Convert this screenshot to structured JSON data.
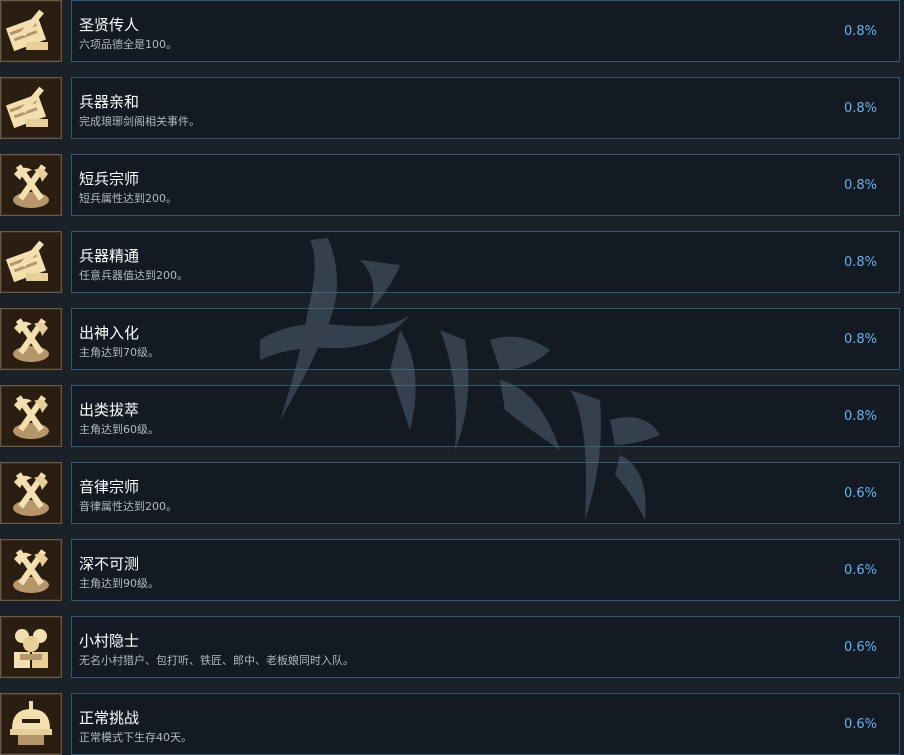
{
  "achievements": [
    {
      "title": "圣贤传人",
      "desc": "六项品德全是100。",
      "percent": "0.8%",
      "icon": "scroll-brush-icon"
    },
    {
      "title": "兵器亲和",
      "desc": "完成琅琊剑阁相关事件。",
      "percent": "0.8%",
      "icon": "scroll-brush-icon"
    },
    {
      "title": "短兵宗师",
      "desc": "短兵属性达到200。",
      "percent": "0.8%",
      "icon": "crossed-weapons-icon"
    },
    {
      "title": "兵器精通",
      "desc": "任意兵器值达到200。",
      "percent": "0.8%",
      "icon": "scroll-brush-icon"
    },
    {
      "title": "出神入化",
      "desc": "主角达到70级。",
      "percent": "0.8%",
      "icon": "crossed-weapons-icon"
    },
    {
      "title": "出类拔萃",
      "desc": "主角达到60级。",
      "percent": "0.8%",
      "icon": "crossed-weapons-icon"
    },
    {
      "title": "音律宗师",
      "desc": "音律属性达到200。",
      "percent": "0.6%",
      "icon": "crossed-weapons-icon"
    },
    {
      "title": "深不可测",
      "desc": "主角达到90级。",
      "percent": "0.6%",
      "icon": "crossed-weapons-icon"
    },
    {
      "title": "小村隐士",
      "desc": "无名小村猎户、包打听、铁匠、郎中、老板娘同时入队。",
      "percent": "0.6%",
      "icon": "villagers-icon"
    },
    {
      "title": "正常挑战",
      "desc": "正常模式下生存40天。",
      "percent": "0.6%",
      "icon": "helmet-icon"
    }
  ],
  "colors": {
    "background": "#1b2129",
    "panel": "#131a23",
    "panel_border": "#2f5a70",
    "percent": "#66b4ee",
    "icon_cream": "#f3dfb0",
    "icon_dark": "#2a1d12"
  }
}
